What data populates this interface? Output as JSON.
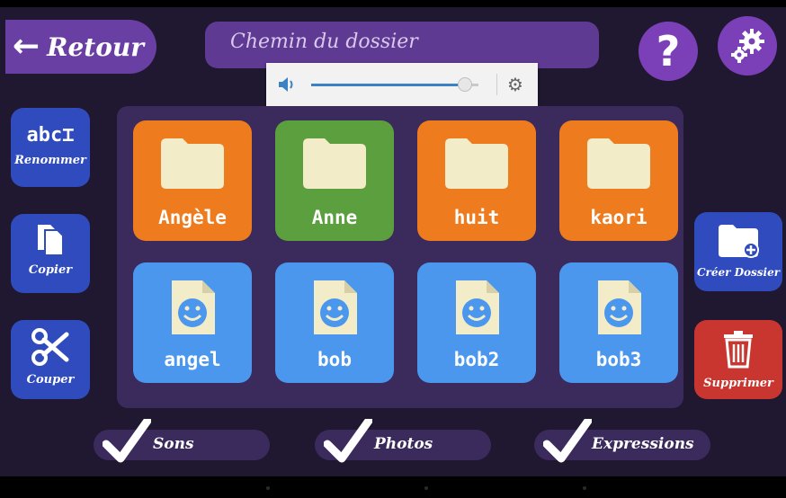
{
  "header": {
    "back_label": "Retour",
    "path_placeholder": "Chemin du dossier"
  },
  "actions": {
    "rename": "Renommer",
    "copy": "Copier",
    "cut": "Couper",
    "new_folder": "Créer Dossier",
    "delete": "Supprimer"
  },
  "volume": {
    "level": 0.92
  },
  "folders": [
    {
      "name": "Angèle",
      "color": "#ee7b1d"
    },
    {
      "name": "Anne",
      "color": "#5b9f3f"
    },
    {
      "name": "huit",
      "color": "#ee7b1d"
    },
    {
      "name": "kaori",
      "color": "#ee7b1d"
    }
  ],
  "profiles": [
    {
      "name": "angel"
    },
    {
      "name": "bob"
    },
    {
      "name": "bob2"
    },
    {
      "name": "bob3"
    }
  ],
  "filters": {
    "sons": "Sons",
    "photos": "Photos",
    "expressions": "Expressions"
  },
  "colors": {
    "background": "#1f1830",
    "accent_purple": "#7b3fb8",
    "action_blue": "#2f4bbe",
    "delete_red": "#c8362f",
    "folder_orange": "#ee7b1d",
    "folder_green": "#5b9f3f",
    "profile_blue": "#4b97ee"
  }
}
